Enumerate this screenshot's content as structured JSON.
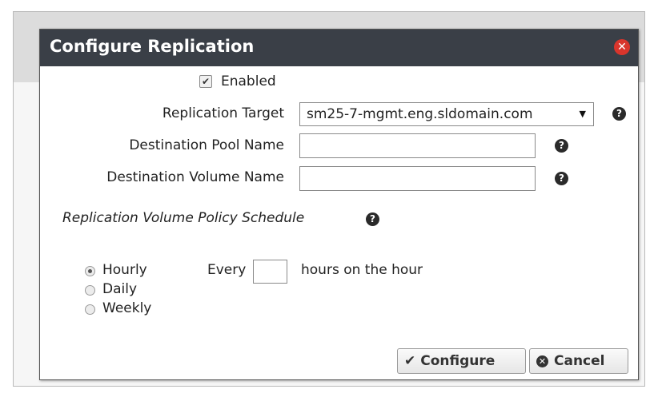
{
  "dialog": {
    "title": "Configure Replication",
    "close_icon": "close-icon"
  },
  "form": {
    "enabled": {
      "label": "Enabled",
      "checked": true
    },
    "replication_target": {
      "label": "Replication Target",
      "value": "sm25-7-mgmt.eng.sldomain.com"
    },
    "destination_pool_name": {
      "label": "Destination Pool Name",
      "value": ""
    },
    "destination_volume_name": {
      "label": "Destination Volume Name",
      "value": ""
    }
  },
  "schedule": {
    "heading": "Replication Volume Policy Schedule",
    "options": [
      {
        "label": "Hourly",
        "selected": true
      },
      {
        "label": "Daily",
        "selected": false
      },
      {
        "label": "Weekly",
        "selected": false
      }
    ],
    "every_label": "Every",
    "hours_value": "",
    "suffix_label": "hours on the hour"
  },
  "buttons": {
    "configure_label": "Configure",
    "cancel_label": "Cancel"
  },
  "colors": {
    "titlebar": "#3a3f47",
    "close": "#d9352c"
  }
}
